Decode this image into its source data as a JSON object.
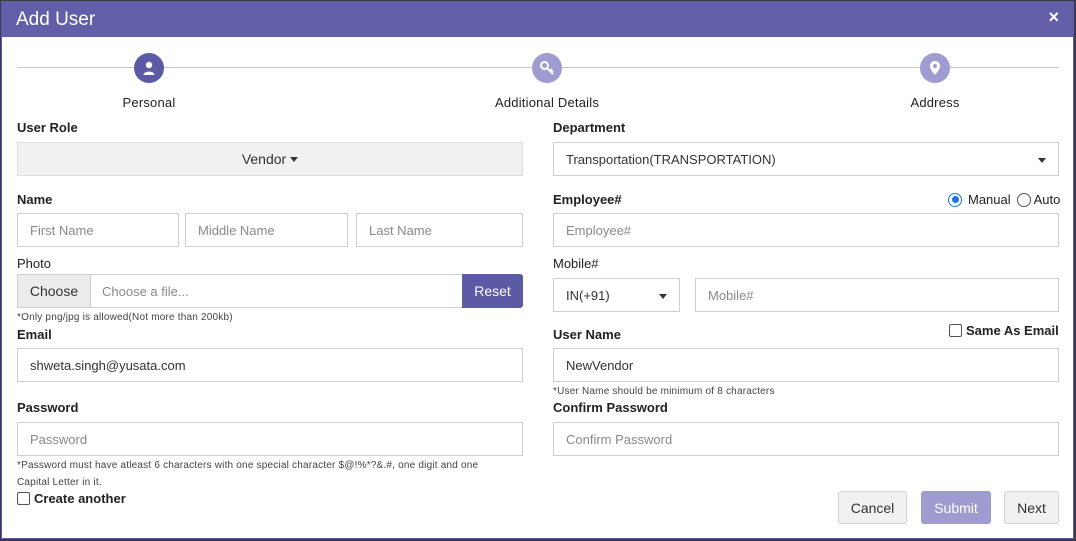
{
  "header": {
    "title": "Add User",
    "close": "×"
  },
  "steps": [
    {
      "label": "Personal",
      "icon": "person-icon",
      "state": "active"
    },
    {
      "label": "Additional Details",
      "icon": "key-icon",
      "state": "inactive"
    },
    {
      "label": "Address",
      "icon": "location-pin-icon",
      "state": "inactive"
    }
  ],
  "form": {
    "user_role": {
      "label": "User Role",
      "value": "Vendor"
    },
    "department": {
      "label": "Department",
      "value": "Transportation(TRANSPORTATION)"
    },
    "name": {
      "label": "Name",
      "first_placeholder": "First Name",
      "middle_placeholder": "Middle Name",
      "last_placeholder": "Last Name"
    },
    "employee": {
      "label": "Employee#",
      "placeholder": "Employee#",
      "mode_options": [
        "Manual",
        "Auto"
      ],
      "selected_mode": "Manual"
    },
    "photo": {
      "label": "Photo",
      "choose_label": "Choose",
      "file_placeholder": "Choose a file...",
      "reset_label": "Reset",
      "hint": "*Only png/jpg is allowed(Not more than 200kb)"
    },
    "mobile": {
      "label": "Mobile#",
      "country_code": "IN(+91)",
      "placeholder": "Mobile#"
    },
    "email": {
      "label": "Email",
      "value": "shweta.singh@yusata.com"
    },
    "username": {
      "label": "User Name",
      "value": "NewVendor",
      "same_as_email_label": "Same As Email",
      "same_as_email_checked": false,
      "hint": "*User Name should be minimum of 8 characters"
    },
    "password": {
      "label": "Password",
      "placeholder": "Password",
      "hint_line1": "*Password must have atleast 6 characters with one special character $@!%*?&.#, one digit and one",
      "hint_line2": "Capital Letter in it."
    },
    "confirm_password": {
      "label": "Confirm Password",
      "placeholder": "Confirm Password"
    },
    "create_another": {
      "label": "Create another",
      "checked": false
    }
  },
  "footer": {
    "cancel": "Cancel",
    "submit": "Submit",
    "next": "Next"
  },
  "colors": {
    "header": "#625fa8",
    "accent": "#5c59a5",
    "accent_light": "#9e9cd0"
  }
}
